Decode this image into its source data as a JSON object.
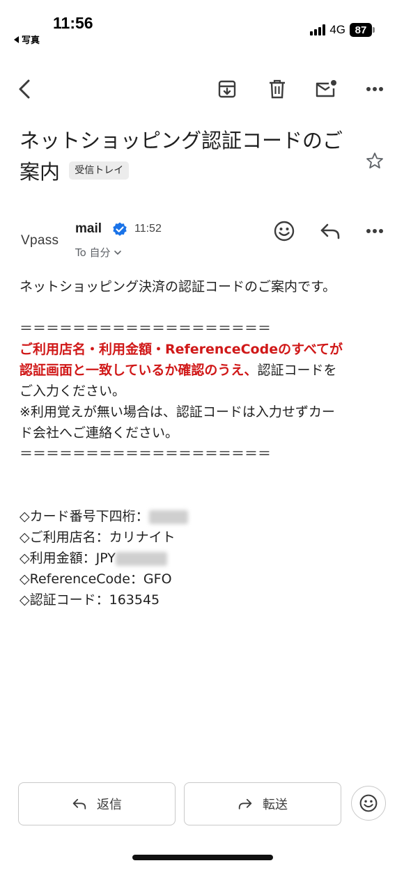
{
  "status": {
    "time": "11:56",
    "back_label": "写真",
    "network": "4G",
    "battery": "87"
  },
  "subject": {
    "title": "ネットショッピング認証コードのご案内",
    "label": "受信トレイ"
  },
  "sender": {
    "logo_text": "Vpass",
    "name": "mail",
    "time": "11:52",
    "to": "To 自分"
  },
  "body": {
    "intro": "ネットショッピング決済の認証コードのご案内です。",
    "separator": "＝＝＝＝＝＝＝＝＝＝＝＝＝＝＝＝＝＝＝",
    "red_line1": "ご利用店名・利用金額・ReferenceCodeのすべてが",
    "red_line2": "認証画面と一致しているか確認のうえ、",
    "normal_tail": "認証コードを",
    "line3": "ご入力ください。",
    "note1": "※利用覚えが無い場合は、認証コードは入力せずカー",
    "note2": "ド会社へご連絡ください。",
    "separator2": "＝＝＝＝＝＝＝＝＝＝＝＝＝＝＝＝＝＝＝",
    "card_label": "◇カード番号下四桁：",
    "shop_label": "◇ご利用店名：カリナイト",
    "amount_label": "◇利用金額：JPY",
    "ref_label": "◇ReferenceCode：GFO",
    "code_label": "◇認証コード：163545"
  },
  "actions": {
    "reply": "返信",
    "forward": "転送"
  },
  "colors": {
    "warning_red": "#d01818",
    "verified_blue": "#1a73e8"
  }
}
